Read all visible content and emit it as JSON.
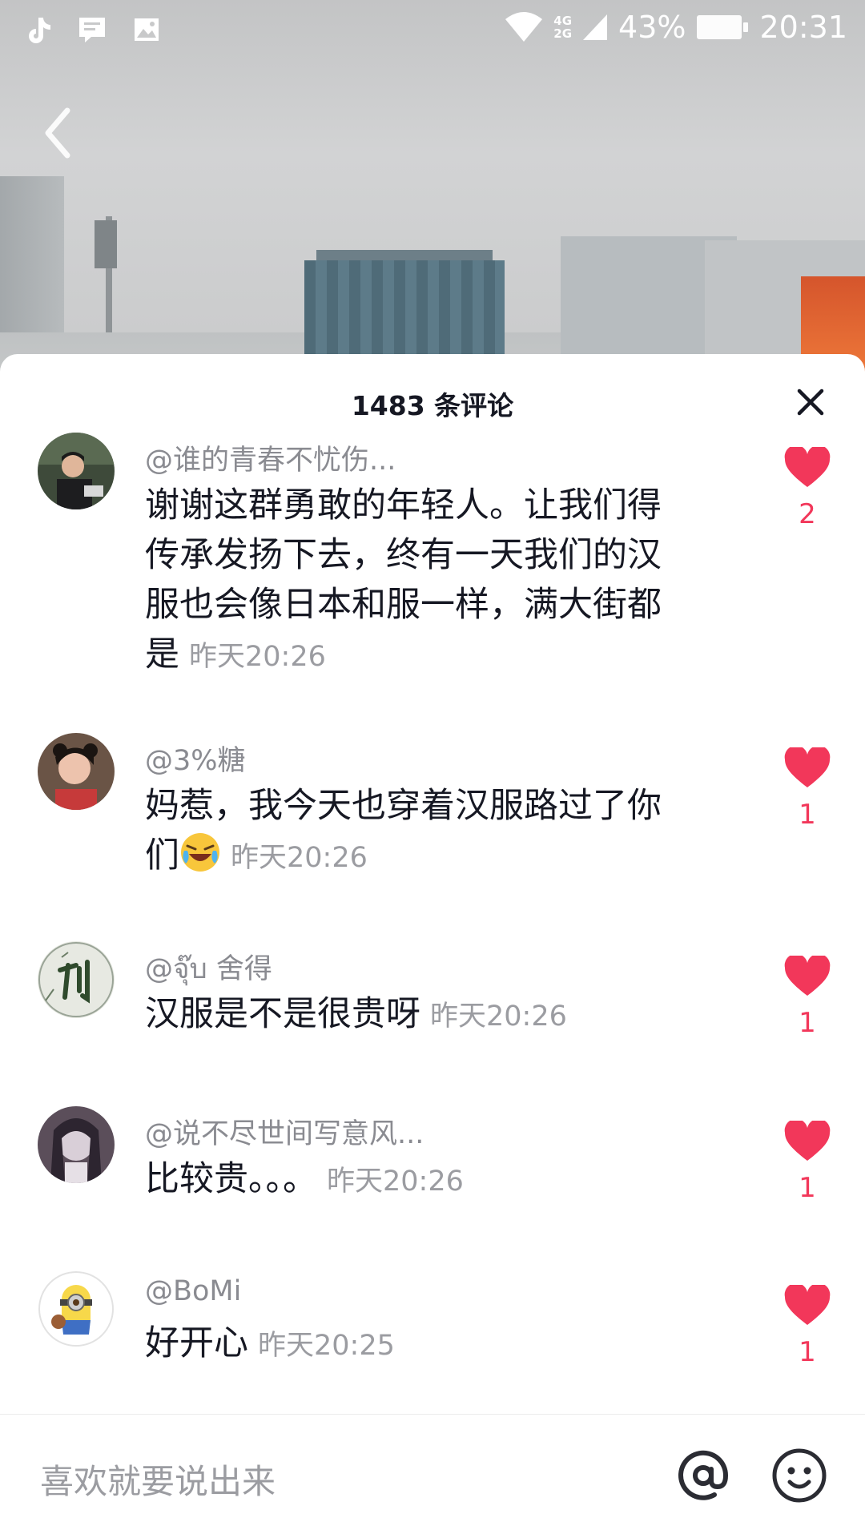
{
  "status_bar": {
    "battery": "43%",
    "time": "20:31",
    "network": "4G\n2G",
    "icons": [
      "tiktok-icon",
      "message-icon",
      "image-icon",
      "wifi-icon",
      "signal-icon",
      "battery-icon"
    ]
  },
  "header": {
    "comment_count": "1483 条评论"
  },
  "comments": [
    {
      "user": "@谁的青春不忧伤...",
      "text": "谢谢这群勇敢的年轻人。让我们得传承发扬下去，终有一天我们的汉服也会像日本和服一样，满大街都是",
      "time": "昨天20:26",
      "likes": "2"
    },
    {
      "user": "@3%糖",
      "text": "妈惹，我今天也穿着汉服路过了你们",
      "time": "昨天20:26",
      "likes": "1"
    },
    {
      "user": "@จุ๊บ 舍得",
      "text": "汉服是不是很贵呀",
      "time": "昨天20:26",
      "likes": "1"
    },
    {
      "user": "@说不尽世间写意风...",
      "text": "比较贵。。。",
      "time": "昨天20:26",
      "likes": "1"
    },
    {
      "user": "@BoMi",
      "text": "好开心",
      "time": "昨天20:25",
      "likes": "1"
    }
  ],
  "input": {
    "placeholder": "喜欢就要说出来"
  },
  "colors": {
    "like": "#f2375a",
    "text_primary": "#161823",
    "text_secondary": "#8a8b91"
  }
}
